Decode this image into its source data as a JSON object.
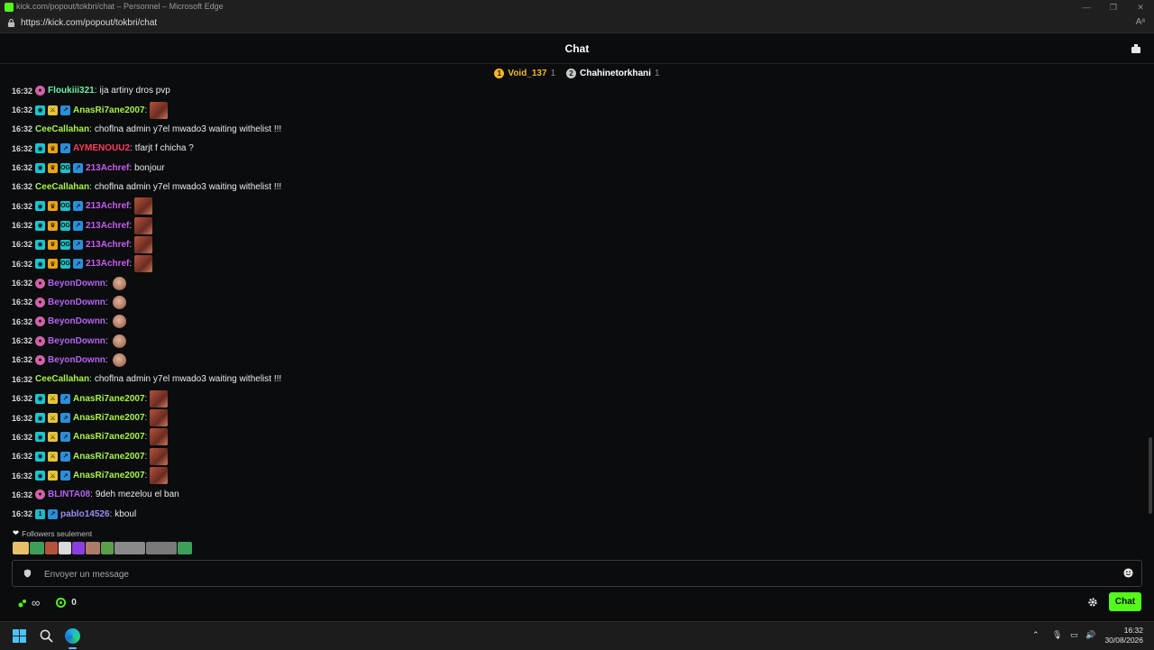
{
  "window": {
    "title": "kick.com/popout/tokbri/chat – Personnel – Microsoft Edge",
    "url": "https://kick.com/popout/tokbri/chat"
  },
  "header": {
    "title": "Chat"
  },
  "gifters": [
    {
      "rank": "1",
      "name": "Void_137",
      "count": "1"
    },
    {
      "rank": "2",
      "name": "Chahinetorkhani",
      "count": "1"
    }
  ],
  "messages": [
    {
      "time": "16:32",
      "badges": [
        "poop"
      ],
      "user": "Floukiii321",
      "color": "#6cf0a5",
      "text": "ija artiny dros pvp"
    },
    {
      "time": "16:32",
      "badges": [
        "sub",
        "sword",
        "gift"
      ],
      "user": "AnasRi7ane2007",
      "color": "#a6f24a",
      "text": "",
      "emote": "square"
    },
    {
      "time": "16:32",
      "badges": [],
      "user": "CeeCallahan",
      "color": "#a6f24a",
      "text": "choflna admin y7el mwado3 waiting withelist !!!"
    },
    {
      "time": "16:32",
      "badges": [
        "sub",
        "vip",
        "gift"
      ],
      "user": "AYMENOUU2",
      "color": "#ff3b5c",
      "text": "tfarjt f chicha ?"
    },
    {
      "time": "16:32",
      "badges": [
        "sub",
        "vip",
        "og",
        "gift"
      ],
      "user": "213Achref",
      "color": "#c85cf0",
      "text": "bonjour"
    },
    {
      "time": "16:32",
      "badges": [],
      "user": "CeeCallahan",
      "color": "#a6f24a",
      "text": "choflna admin y7el mwado3 waiting withelist !!!"
    },
    {
      "time": "16:32",
      "badges": [
        "sub",
        "vip",
        "og",
        "gift"
      ],
      "user": "213Achref",
      "color": "#c85cf0",
      "text": "",
      "emote": "square"
    },
    {
      "time": "16:32",
      "badges": [
        "sub",
        "vip",
        "og",
        "gift"
      ],
      "user": "213Achref",
      "color": "#c85cf0",
      "text": "",
      "emote": "square"
    },
    {
      "time": "16:32",
      "badges": [
        "sub",
        "vip",
        "og",
        "gift"
      ],
      "user": "213Achref",
      "color": "#c85cf0",
      "text": "",
      "emote": "square"
    },
    {
      "time": "16:32",
      "badges": [
        "sub",
        "vip",
        "og",
        "gift"
      ],
      "user": "213Achref",
      "color": "#c85cf0",
      "text": "",
      "emote": "square"
    },
    {
      "time": "16:32",
      "badges": [
        "poop"
      ],
      "user": "BeyonDownn",
      "color": "#b463f0",
      "text": "",
      "emote": "face"
    },
    {
      "time": "16:32",
      "badges": [
        "poop"
      ],
      "user": "BeyonDownn",
      "color": "#b463f0",
      "text": "",
      "emote": "face"
    },
    {
      "time": "16:32",
      "badges": [
        "poop"
      ],
      "user": "BeyonDownn",
      "color": "#b463f0",
      "text": "",
      "emote": "face"
    },
    {
      "time": "16:32",
      "badges": [
        "poop"
      ],
      "user": "BeyonDownn",
      "color": "#b463f0",
      "text": "",
      "emote": "face"
    },
    {
      "time": "16:32",
      "badges": [
        "poop"
      ],
      "user": "BeyonDownn",
      "color": "#b463f0",
      "text": "",
      "emote": "face"
    },
    {
      "time": "16:32",
      "badges": [],
      "user": "CeeCallahan",
      "color": "#a6f24a",
      "text": "choflna admin y7el mwado3 waiting withelist !!!"
    },
    {
      "time": "16:32",
      "badges": [
        "sub",
        "sword",
        "gift"
      ],
      "user": "AnasRi7ane2007",
      "color": "#a6f24a",
      "text": "",
      "emote": "square"
    },
    {
      "time": "16:32",
      "badges": [
        "sub",
        "sword",
        "gift"
      ],
      "user": "AnasRi7ane2007",
      "color": "#a6f24a",
      "text": "",
      "emote": "square"
    },
    {
      "time": "16:32",
      "badges": [
        "sub",
        "sword",
        "gift"
      ],
      "user": "AnasRi7ane2007",
      "color": "#a6f24a",
      "text": "",
      "emote": "square"
    },
    {
      "time": "16:32",
      "badges": [
        "sub",
        "sword",
        "gift"
      ],
      "user": "AnasRi7ane2007",
      "color": "#a6f24a",
      "text": "",
      "emote": "square"
    },
    {
      "time": "16:32",
      "badges": [
        "sub",
        "sword",
        "gift"
      ],
      "user": "AnasRi7ane2007",
      "color": "#a6f24a",
      "text": "",
      "emote": "square"
    },
    {
      "time": "16:32",
      "badges": [
        "poop"
      ],
      "user": "BLINTA08",
      "color": "#b463f0",
      "text": "9deh mezelou el ban"
    },
    {
      "time": "16:32",
      "badges": [
        "one",
        "gift"
      ],
      "user": "pablo14526",
      "color": "#9b8cf5",
      "text": "kboul"
    }
  ],
  "followers_label": "Followers seulement",
  "emote_bar": [
    "#e8c06a",
    "#3f9f5a",
    "#b4533b",
    "#d9d9d9",
    "#8b3fe0",
    "#b07a6a",
    "#5c9f4a",
    "#8a8a8a",
    "#7a7a7a",
    "#3f9f5a",
    "#3f8f4a"
  ],
  "input": {
    "placeholder": "Envoyer un message"
  },
  "stats": {
    "viewers_symbol": "∞",
    "points": "0"
  },
  "send_label": "Chat",
  "clock": {
    "time": "16:32",
    "date": "30/08/2026"
  },
  "colors": {
    "accent": "#53fc18",
    "background": "#0b0c0e"
  }
}
